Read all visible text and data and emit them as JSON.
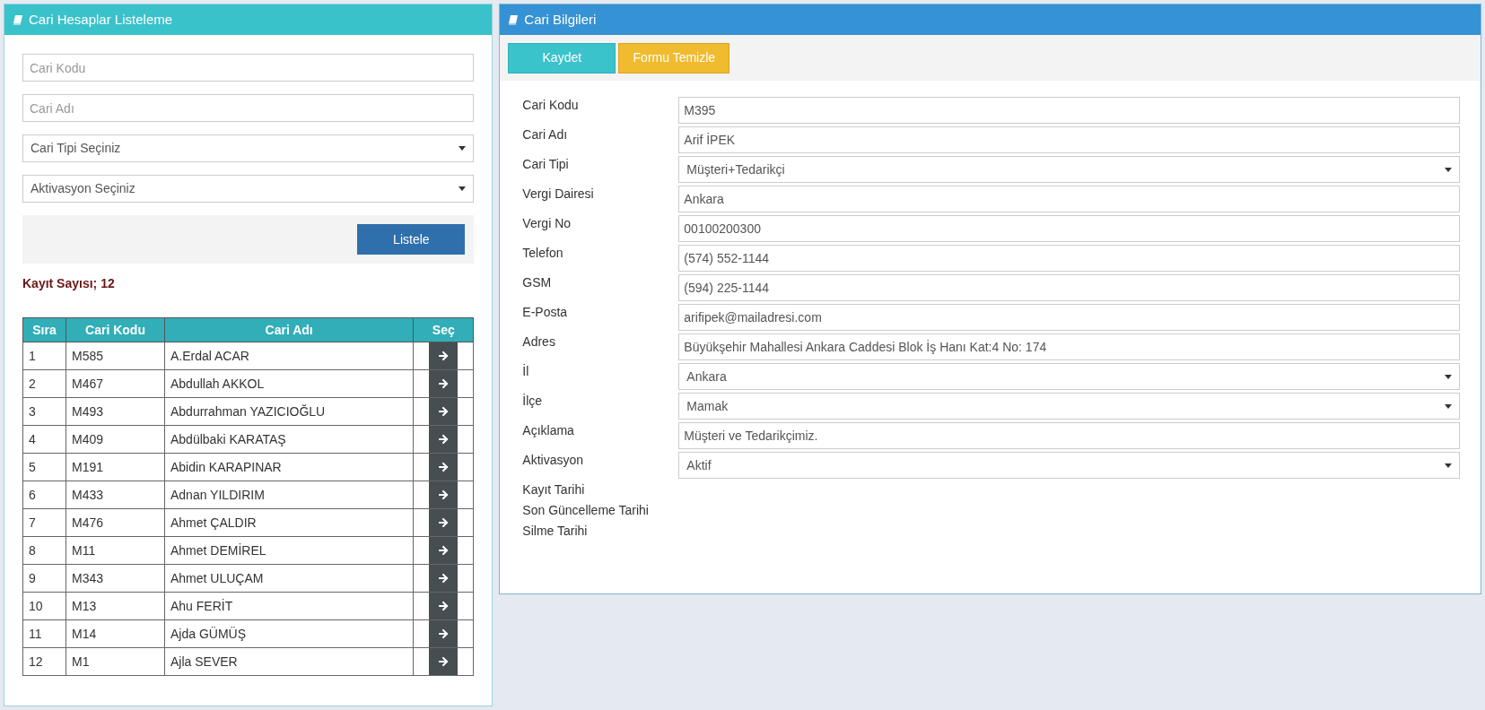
{
  "list_panel": {
    "title": "Cari Hesaplar Listeleme",
    "filters": [
      {
        "kind": "text",
        "placeholder": "Cari Kodu"
      },
      {
        "kind": "text",
        "placeholder": "Cari Adı"
      },
      {
        "kind": "select",
        "value": "Cari Tipi Seçiniz"
      },
      {
        "kind": "select",
        "value": "Aktivasyon Seçiniz"
      }
    ],
    "list_button": "Listele",
    "record_count": "Kayıt Sayısı; 12",
    "table": {
      "columns": [
        "Sıra",
        "Cari Kodu",
        "Cari Adı",
        "Seç"
      ],
      "rows": [
        [
          "1",
          "M585",
          "A.Erdal ACAR"
        ],
        [
          "2",
          "M467",
          "Abdullah AKKOL"
        ],
        [
          "3",
          "M493",
          "Abdurrahman YAZICIOĞLU"
        ],
        [
          "4",
          "M409",
          "Abdülbaki KARATAŞ"
        ],
        [
          "5",
          "M191",
          "Abidin KARAPINAR"
        ],
        [
          "6",
          "M433",
          "Adnan YILDIRIM"
        ],
        [
          "7",
          "M476",
          "Ahmet ÇALDIR"
        ],
        [
          "8",
          "M11",
          "Ahmet DEMİREL"
        ],
        [
          "9",
          "M343",
          "Ahmet ULUÇAM"
        ],
        [
          "10",
          "M13",
          "Ahu FERİT"
        ],
        [
          "11",
          "M14",
          "Ajda GÜMÜŞ"
        ],
        [
          "12",
          "M1",
          "Ajla SEVER"
        ]
      ]
    }
  },
  "detail_panel": {
    "title": "Cari Bilgileri",
    "buttons": [
      {
        "kind": "save",
        "label": "Kaydet"
      },
      {
        "kind": "clear",
        "label": "Formu Temizle"
      }
    ],
    "fields": [
      {
        "kind": "text",
        "label": "Cari Kodu",
        "value": "M395"
      },
      {
        "kind": "text",
        "label": "Cari Adı",
        "value": "Arif İPEK"
      },
      {
        "kind": "select",
        "label": "Cari Tipi",
        "value": "Müşteri+Tedarikçi"
      },
      {
        "kind": "text",
        "label": "Vergi Dairesi",
        "value": "Ankara"
      },
      {
        "kind": "text",
        "label": "Vergi No",
        "value": "00100200300"
      },
      {
        "kind": "text",
        "label": "Telefon",
        "value": "(574) 552-1144"
      },
      {
        "kind": "text",
        "label": "GSM",
        "value": "(594) 225-1144"
      },
      {
        "kind": "text",
        "label": "E-Posta",
        "value": "arifipek@mailadresi.com"
      },
      {
        "kind": "text",
        "label": "Adres",
        "value": "Büyükşehir Mahallesi Ankara Caddesi Blok İş Hanı Kat:4 No: 174"
      },
      {
        "kind": "select",
        "label": "İl",
        "value": "Ankara"
      },
      {
        "kind": "select",
        "label": "İlçe",
        "value": "Mamak"
      },
      {
        "kind": "text",
        "label": "Açıklama",
        "value": "Müşteri ve Tedarikçimiz."
      },
      {
        "kind": "select",
        "label": "Aktivasyon",
        "value": "Aktif"
      },
      {
        "kind": "info",
        "label": "Kayıt Tarihi"
      },
      {
        "kind": "info",
        "label": "Son Güncelleme Tarihi"
      },
      {
        "kind": "info",
        "label": "Silme Tarihi"
      }
    ]
  }
}
